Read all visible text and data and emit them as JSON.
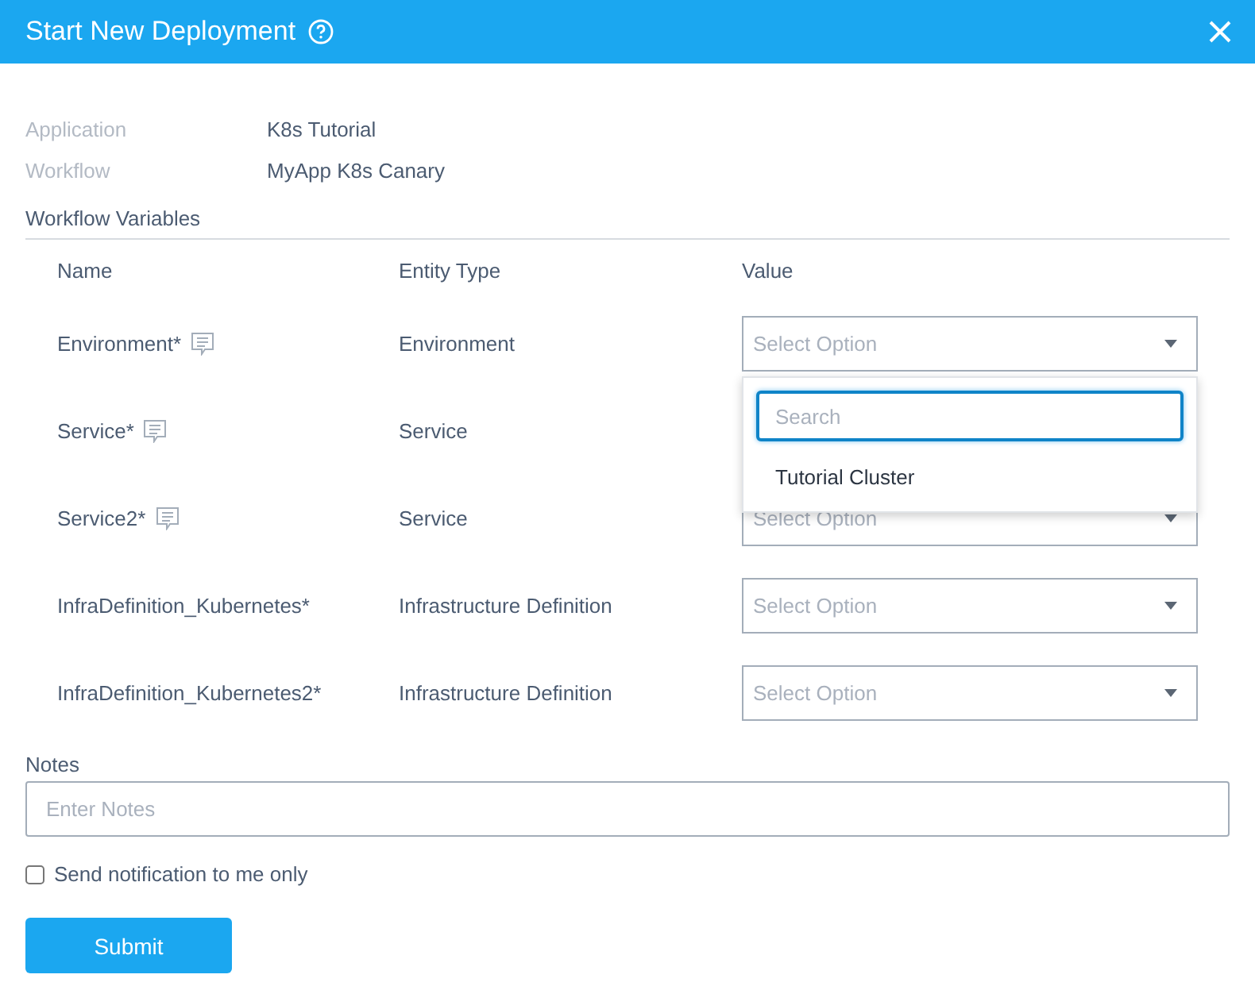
{
  "window": {
    "title": "Start New Deployment"
  },
  "summary": [
    {
      "label": "Application",
      "value": "K8s Tutorial"
    },
    {
      "label": "Workflow",
      "value": "MyApp K8s Canary"
    }
  ],
  "variables": {
    "title": "Workflow Variables",
    "columns": [
      "Name",
      "Entity Type",
      "Value"
    ],
    "rows": [
      {
        "name": "Environment*",
        "has_note": true,
        "entity_type": "Environment",
        "select": {
          "placeholder": "Select Option"
        },
        "dropdown": {
          "search_placeholder": "Search",
          "options": [
            {
              "label": "Tutorial Cluster"
            }
          ]
        }
      },
      {
        "name": "Service*",
        "has_note": true,
        "entity_type": "Service"
      },
      {
        "name": "Service2*",
        "has_note": true,
        "entity_type": "Service",
        "select": {
          "placeholder": "Select Option"
        }
      },
      {
        "name": "InfraDefinition_Kubernetes*",
        "has_note": false,
        "entity_type": "Infrastructure Definition",
        "select": {
          "placeholder": "Select Option"
        }
      },
      {
        "name": "InfraDefinition_Kubernetes2*",
        "has_note": false,
        "entity_type": "Infrastructure Definition",
        "select": {
          "placeholder": "Select Option"
        }
      }
    ]
  },
  "notes": {
    "label": "Notes",
    "placeholder": "Enter Notes"
  },
  "notify": {
    "label": "Send notification to me only",
    "checked": false
  },
  "submit": {
    "label": "Submit"
  }
}
